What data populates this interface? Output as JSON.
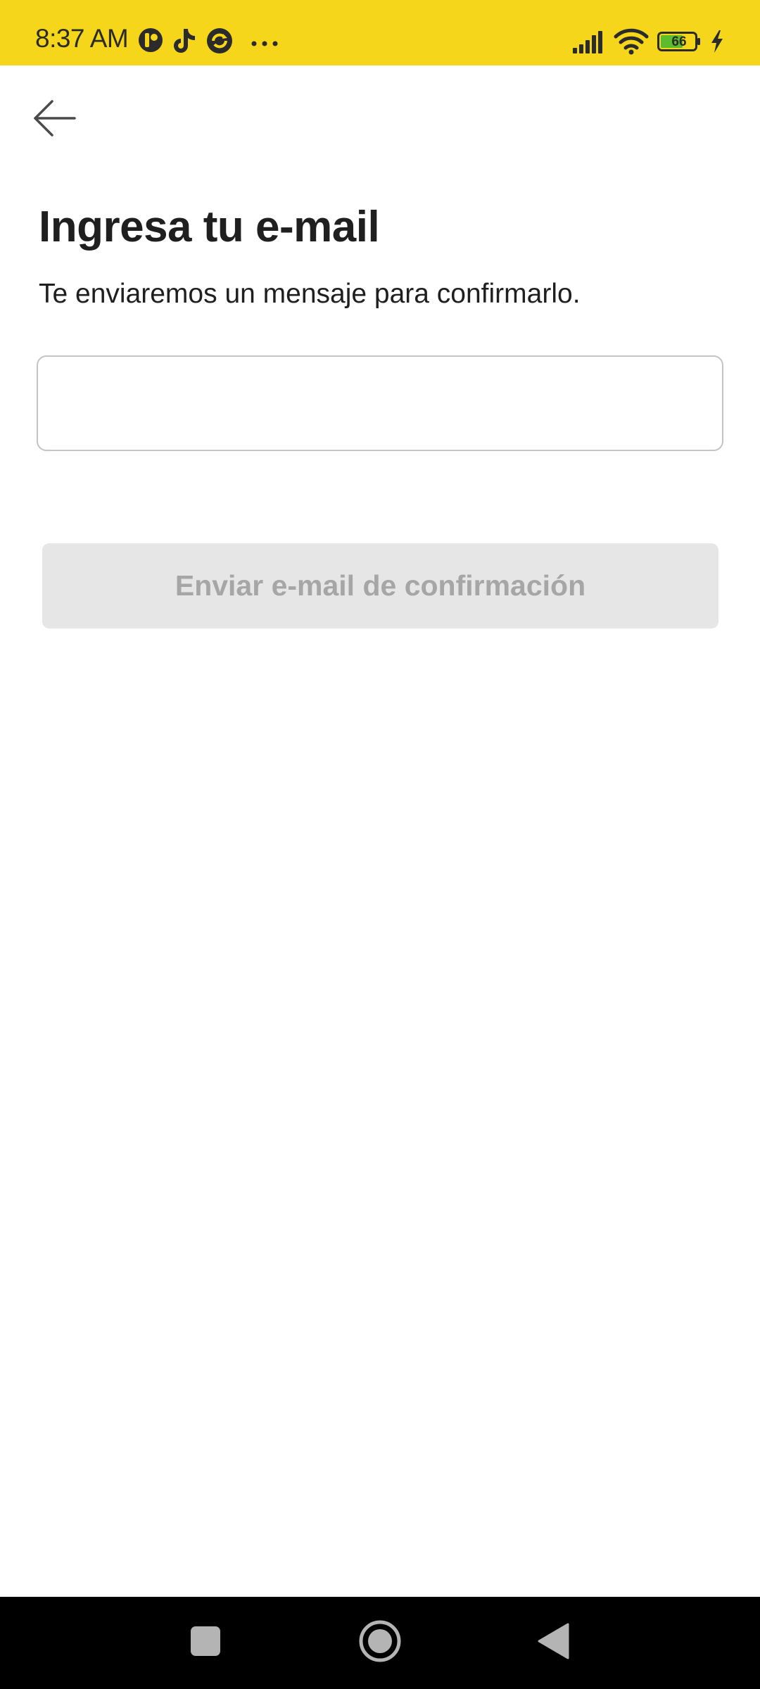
{
  "status_bar": {
    "time": "8:37 AM",
    "battery_level": "66",
    "notification_icons": [
      "app-notification-icon",
      "tiktok-icon",
      "sync-app-icon",
      "more-dots-icon"
    ],
    "system_icons": [
      "signal-icon",
      "wifi-icon",
      "battery-icon",
      "charging-icon"
    ],
    "background_color": "#f6d61a"
  },
  "header": {
    "back_icon": "arrow-left-icon"
  },
  "main": {
    "title": "Ingresa tu e-mail",
    "subtitle": "Te enviaremos un mensaje para confirmarlo.",
    "email_input": {
      "value": "",
      "placeholder": ""
    },
    "submit_button": {
      "label": "Enviar e-mail de confirmación",
      "state": "disabled"
    }
  },
  "nav_bar": {
    "items": [
      "recents-square-icon",
      "home-circle-icon",
      "back-triangle-icon"
    ]
  }
}
